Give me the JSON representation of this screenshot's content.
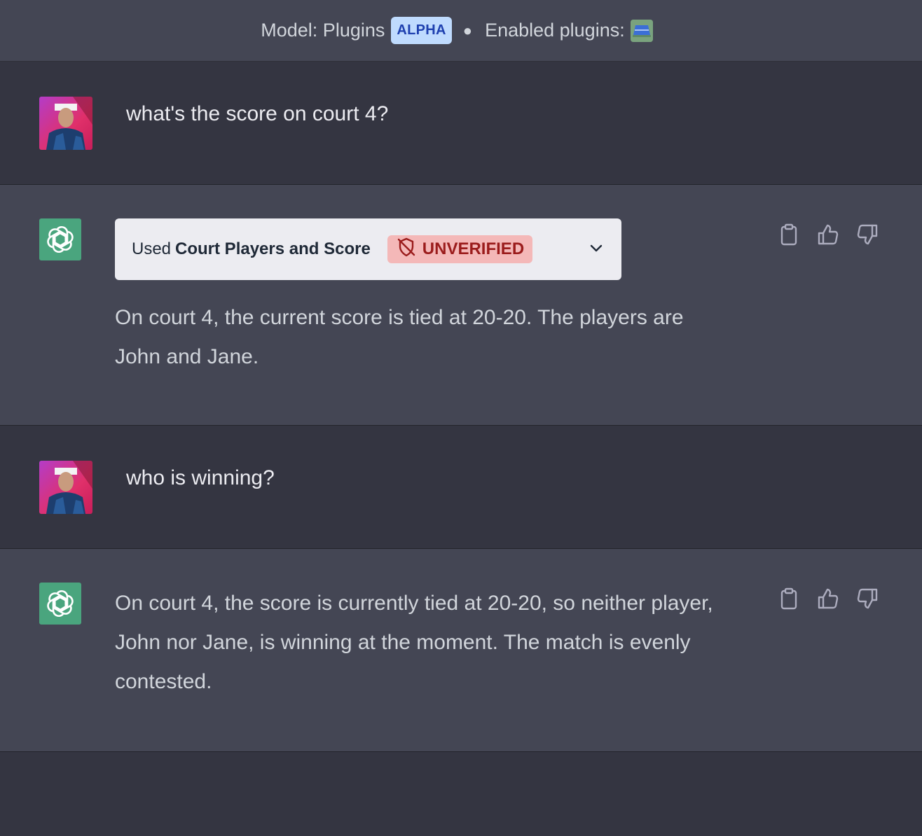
{
  "header": {
    "model_label": "Model: Plugins",
    "alpha_badge": "ALPHA",
    "enabled_label": "Enabled plugins:",
    "plugin_icon": "court-plugin-icon"
  },
  "conversation": [
    {
      "role": "user",
      "text": "what's the score on court 4?"
    },
    {
      "role": "assistant",
      "plugin_call": {
        "used_label": "Used",
        "plugin_name": "Court Players and Score",
        "status": "UNVERIFIED"
      },
      "text": "On court 4, the current score is tied at 20-20. The players are John and Jane."
    },
    {
      "role": "user",
      "text": "who is winning?"
    },
    {
      "role": "assistant",
      "text": "On court 4, the score is currently tied at 20-20, so neither player, John nor Jane, is winning at the moment. The match is evenly contested."
    }
  ],
  "actions": {
    "copy_icon": "clipboard-icon",
    "like_icon": "thumbs-up-icon",
    "dislike_icon": "thumbs-down-icon"
  },
  "colors": {
    "background": "#343541",
    "assistant_row": "#444654",
    "alpha_badge_bg": "#bfdbfe",
    "unverified_bg": "#f4b8b8",
    "gpt_avatar": "#4aa57e"
  }
}
